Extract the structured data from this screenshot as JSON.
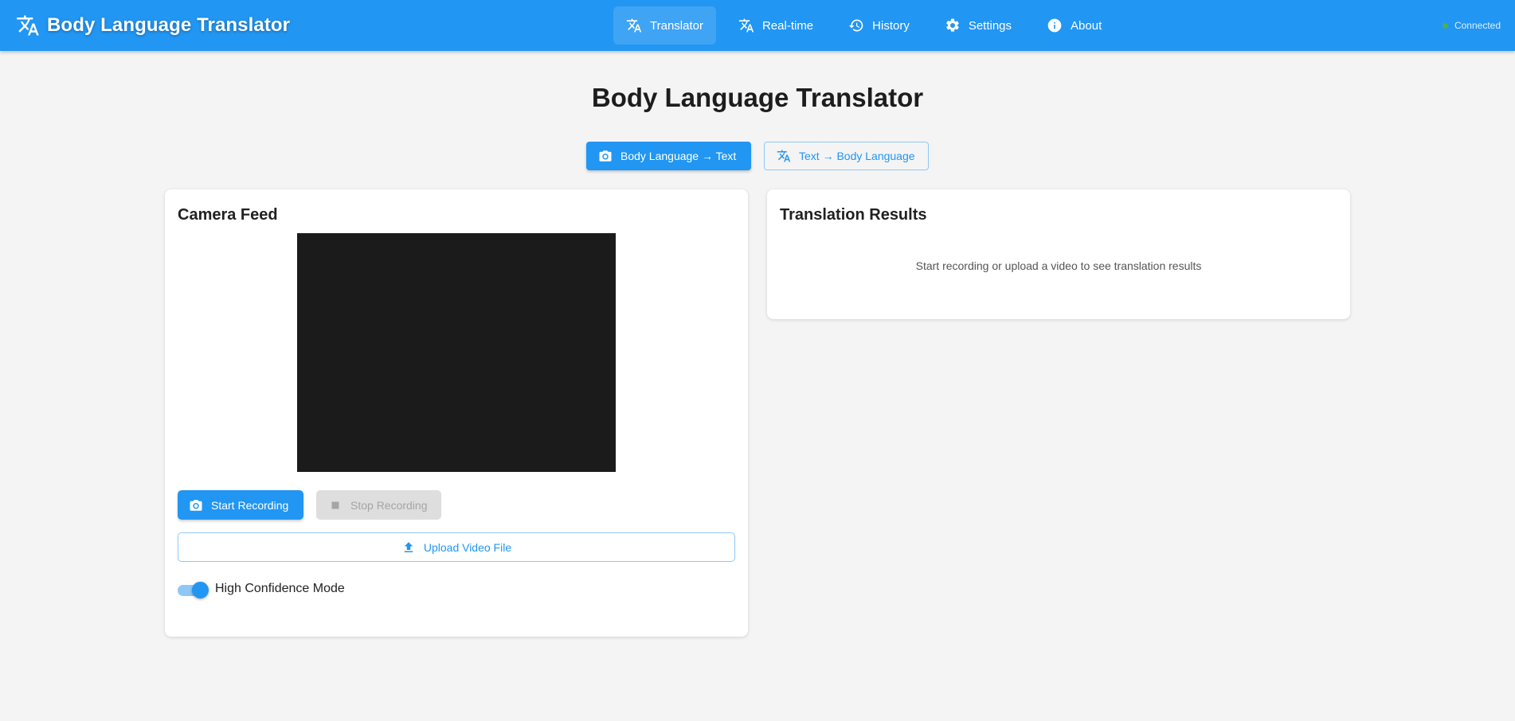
{
  "appbar": {
    "title": "Body Language Translator",
    "nav": [
      {
        "label": "Translator",
        "icon": "translate-icon",
        "active": true
      },
      {
        "label": "Real-time",
        "icon": "translate-icon",
        "active": false
      },
      {
        "label": "History",
        "icon": "history-icon",
        "active": false
      },
      {
        "label": "Settings",
        "icon": "gear-icon",
        "active": false
      },
      {
        "label": "About",
        "icon": "info-icon",
        "active": false
      }
    ],
    "status": "Connected",
    "status_color": "#4caf50"
  },
  "page": {
    "title": "Body Language Translator"
  },
  "modes": {
    "body_to_text": "Body Language → Text",
    "text_to_body": "Text → Body Language",
    "selected": "body_to_text"
  },
  "camera": {
    "title": "Camera Feed",
    "start_label": "Start Recording",
    "stop_label": "Stop Recording",
    "stop_disabled": true,
    "upload_label": "Upload Video File",
    "toggle_label": "High Confidence Mode",
    "toggle_on": true
  },
  "results": {
    "title": "Translation Results",
    "empty_message": "Start recording or upload a video to see translation results"
  },
  "colors": {
    "primary": "#2196f3",
    "background": "#f4f4f4",
    "video_background": "#1b1b1b"
  }
}
